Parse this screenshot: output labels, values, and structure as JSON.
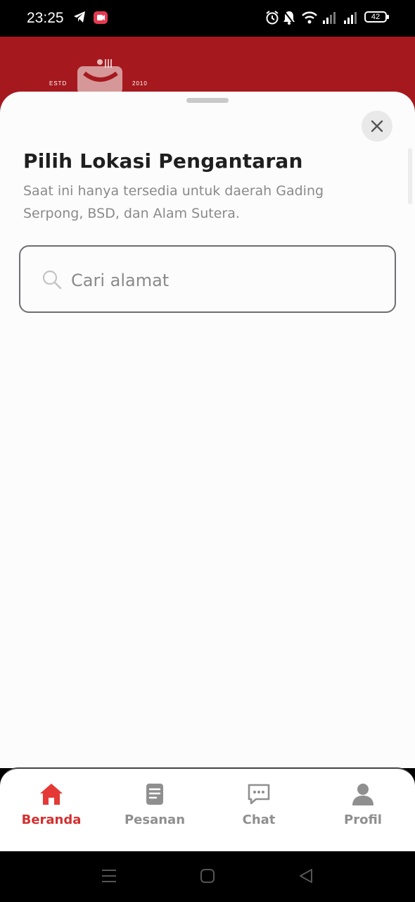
{
  "status_bar": {
    "time": "23:25",
    "battery": "42",
    "icons": [
      "telegram-icon",
      "screen-record-icon",
      "alarm-icon",
      "bell-icon",
      "wifi-icon",
      "signal-icon",
      "signal-icon",
      "battery-icon"
    ]
  },
  "header": {
    "logo_left": "ESTD",
    "logo_right": "2010",
    "color": "#a5191e"
  },
  "sheet": {
    "title": "Pilih Lokasi Pengantaran",
    "subtitle": "Saat ini hanya tersedia untuk daerah Gading Serpong, BSD, dan Alam Sutera.",
    "search": {
      "placeholder": "Cari alamat",
      "value": ""
    }
  },
  "bottom_nav": {
    "active_color": "#d32f2f",
    "items": [
      {
        "label": "Beranda",
        "icon": "home-icon",
        "active": true
      },
      {
        "label": "Pesanan",
        "icon": "orders-icon",
        "active": false
      },
      {
        "label": "Chat",
        "icon": "chat-icon",
        "active": false
      },
      {
        "label": "Profil",
        "icon": "profile-icon",
        "active": false
      }
    ]
  },
  "system_nav": [
    "menu-icon",
    "home-square-icon",
    "back-icon"
  ]
}
